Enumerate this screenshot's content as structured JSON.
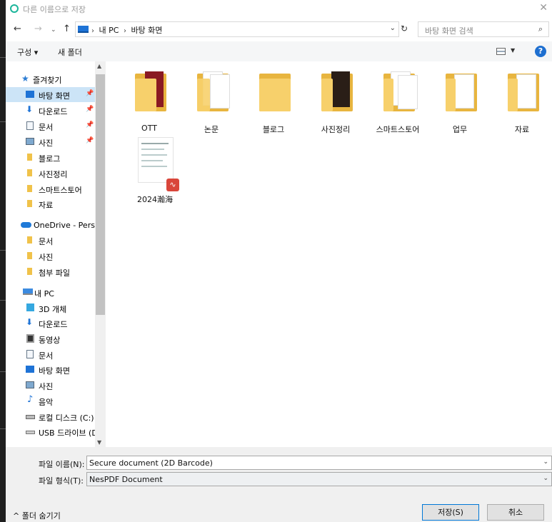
{
  "window": {
    "title": "다른 이름으로 저장",
    "close": "✕"
  },
  "nav": {
    "back": "←",
    "forward": "→",
    "history": "⌄",
    "up": "↑",
    "path": [
      "내 PC",
      "바탕 화면"
    ],
    "refresh": "↻",
    "search_placeholder": "바탕 화면 검색",
    "search_icon": "⌕"
  },
  "toolbar": {
    "organize": "구성 ▾",
    "new_folder": "새 폴더",
    "view_dropdown": "▼",
    "help": "?"
  },
  "sidebar": {
    "items": [
      {
        "label": "즐겨찾기",
        "icon": "star-icon",
        "pinned": false
      },
      {
        "label": "바탕 화면",
        "icon": "desktop-icon",
        "pinned": true,
        "selected": true
      },
      {
        "label": "다운로드",
        "icon": "download-icon",
        "pinned": true
      },
      {
        "label": "문서",
        "icon": "document-icon",
        "pinned": true
      },
      {
        "label": "사진",
        "icon": "pictures-icon",
        "pinned": true
      },
      {
        "label": "블로그",
        "icon": "folder-icon"
      },
      {
        "label": "사진정리",
        "icon": "folder-icon"
      },
      {
        "label": "스마트스토어",
        "icon": "folder-icon"
      },
      {
        "label": "자료",
        "icon": "folder-icon"
      },
      {
        "label": "OneDrive - Perso",
        "icon": "cloud-icon"
      },
      {
        "label": "문서",
        "icon": "folder-icon"
      },
      {
        "label": "사진",
        "icon": "folder-icon"
      },
      {
        "label": "첨부 파일",
        "icon": "folder-icon"
      },
      {
        "label": "내 PC",
        "icon": "pc-icon"
      },
      {
        "label": "3D 개체",
        "icon": "cube-icon"
      },
      {
        "label": "다운로드",
        "icon": "download-icon"
      },
      {
        "label": "동영상",
        "icon": "video-icon"
      },
      {
        "label": "문서",
        "icon": "document-icon"
      },
      {
        "label": "바탕 화면",
        "icon": "desktop-icon"
      },
      {
        "label": "사진",
        "icon": "pictures-icon"
      },
      {
        "label": "음악",
        "icon": "music-icon"
      },
      {
        "label": "로컬 디스크 (C:)",
        "icon": "drive-icon"
      },
      {
        "label": "USB 드라이브 (D",
        "icon": "usb-icon"
      }
    ]
  },
  "files": [
    {
      "name": "OTT",
      "kind": "folder"
    },
    {
      "name": "논문",
      "kind": "folder"
    },
    {
      "name": "블로그",
      "kind": "folder"
    },
    {
      "name": "사진정리",
      "kind": "folder"
    },
    {
      "name": "스마트스토어",
      "kind": "folder"
    },
    {
      "name": "업무",
      "kind": "folder"
    },
    {
      "name": "자료",
      "kind": "folder"
    },
    {
      "name": "2024瀚海",
      "kind": "pdf"
    }
  ],
  "form": {
    "filename_label": "파일 이름(N):",
    "filename_value": "Secure document (2D Barcode)",
    "filetype_label": "파일 형식(T):",
    "filetype_value": "NesPDF Document",
    "dropdown": "⌄"
  },
  "footer": {
    "hide_folders": "^  폴더 숨기기",
    "save": "저장(S)",
    "cancel": "취소"
  },
  "colors": {
    "selection": "#cce4f7",
    "accent": "#0078d7",
    "folder": "#f7d06b"
  }
}
